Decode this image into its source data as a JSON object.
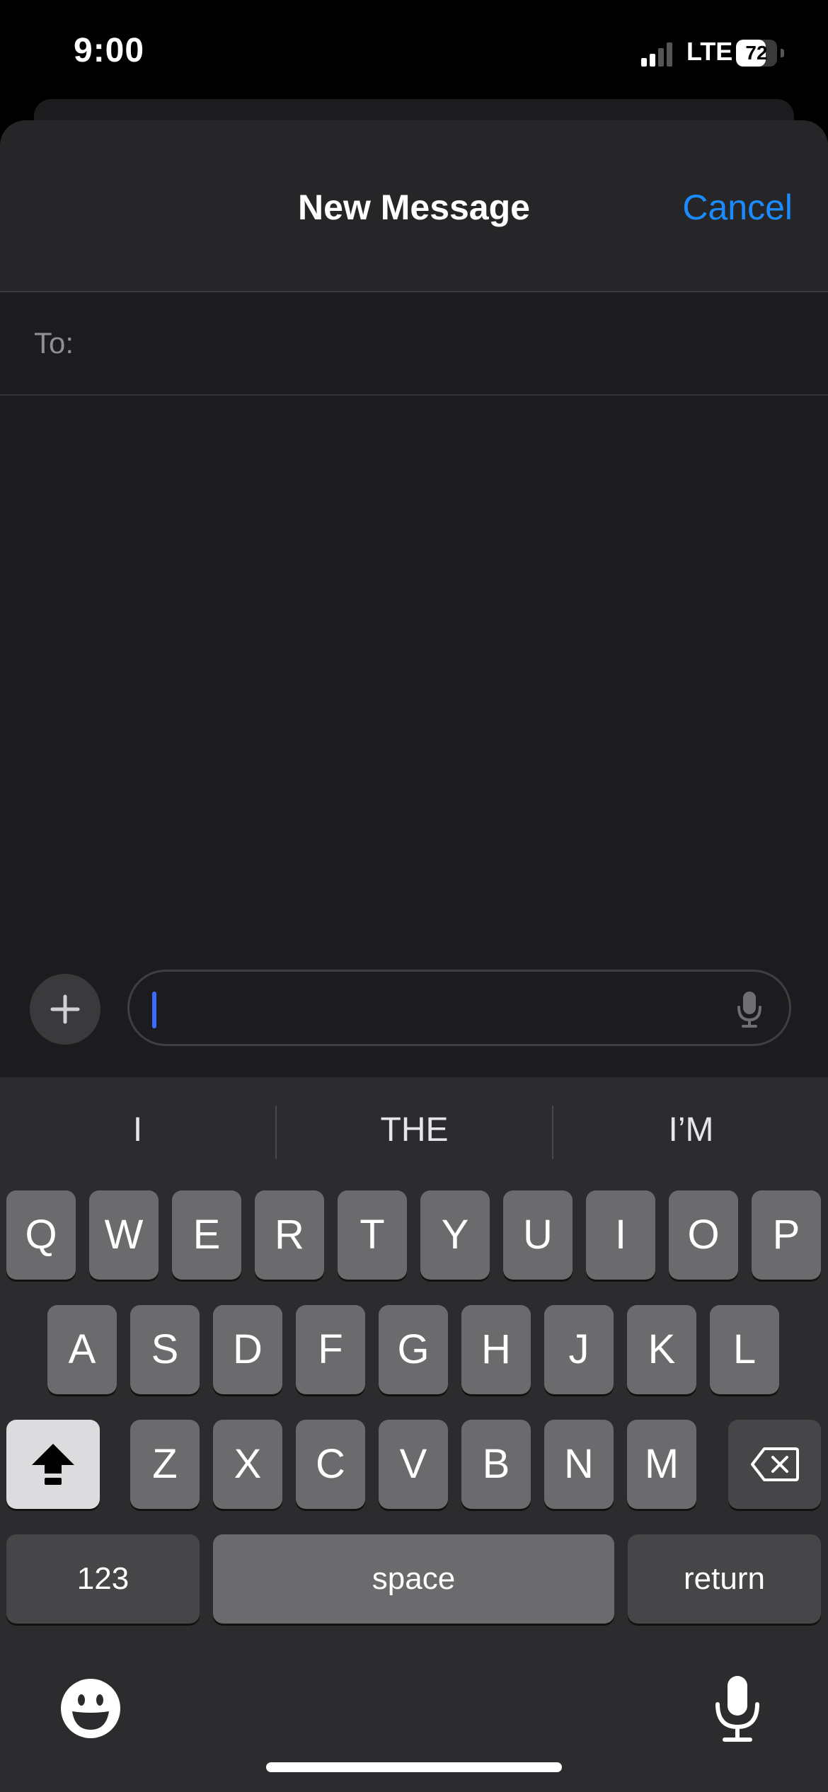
{
  "status_bar": {
    "time": "9:00",
    "network": "LTE",
    "battery_level": "72",
    "signal_bars_active": 2,
    "signal_bars_total": 4
  },
  "header": {
    "title": "New Message",
    "cancel_label": "Cancel",
    "accent_color": "#1a8cff"
  },
  "recipient": {
    "label": "To:"
  },
  "composer": {
    "plus_icon": "plus-icon",
    "mic_icon": "microphone-icon"
  },
  "keyboard": {
    "suggestions": [
      "I",
      "THE",
      "I’M"
    ],
    "row1": [
      "Q",
      "W",
      "E",
      "R",
      "T",
      "Y",
      "U",
      "I",
      "O",
      "P"
    ],
    "row2": [
      "A",
      "S",
      "D",
      "F",
      "G",
      "H",
      "J",
      "K",
      "L"
    ],
    "row3": [
      "Z",
      "X",
      "C",
      "V",
      "B",
      "N",
      "M"
    ],
    "numbers_label": "123",
    "space_label": "space",
    "return_label": "return",
    "shift_icon": "shift-icon",
    "delete_icon": "delete-icon",
    "emoji_icon": "emoji-icon",
    "dictation_icon": "microphone-icon"
  }
}
